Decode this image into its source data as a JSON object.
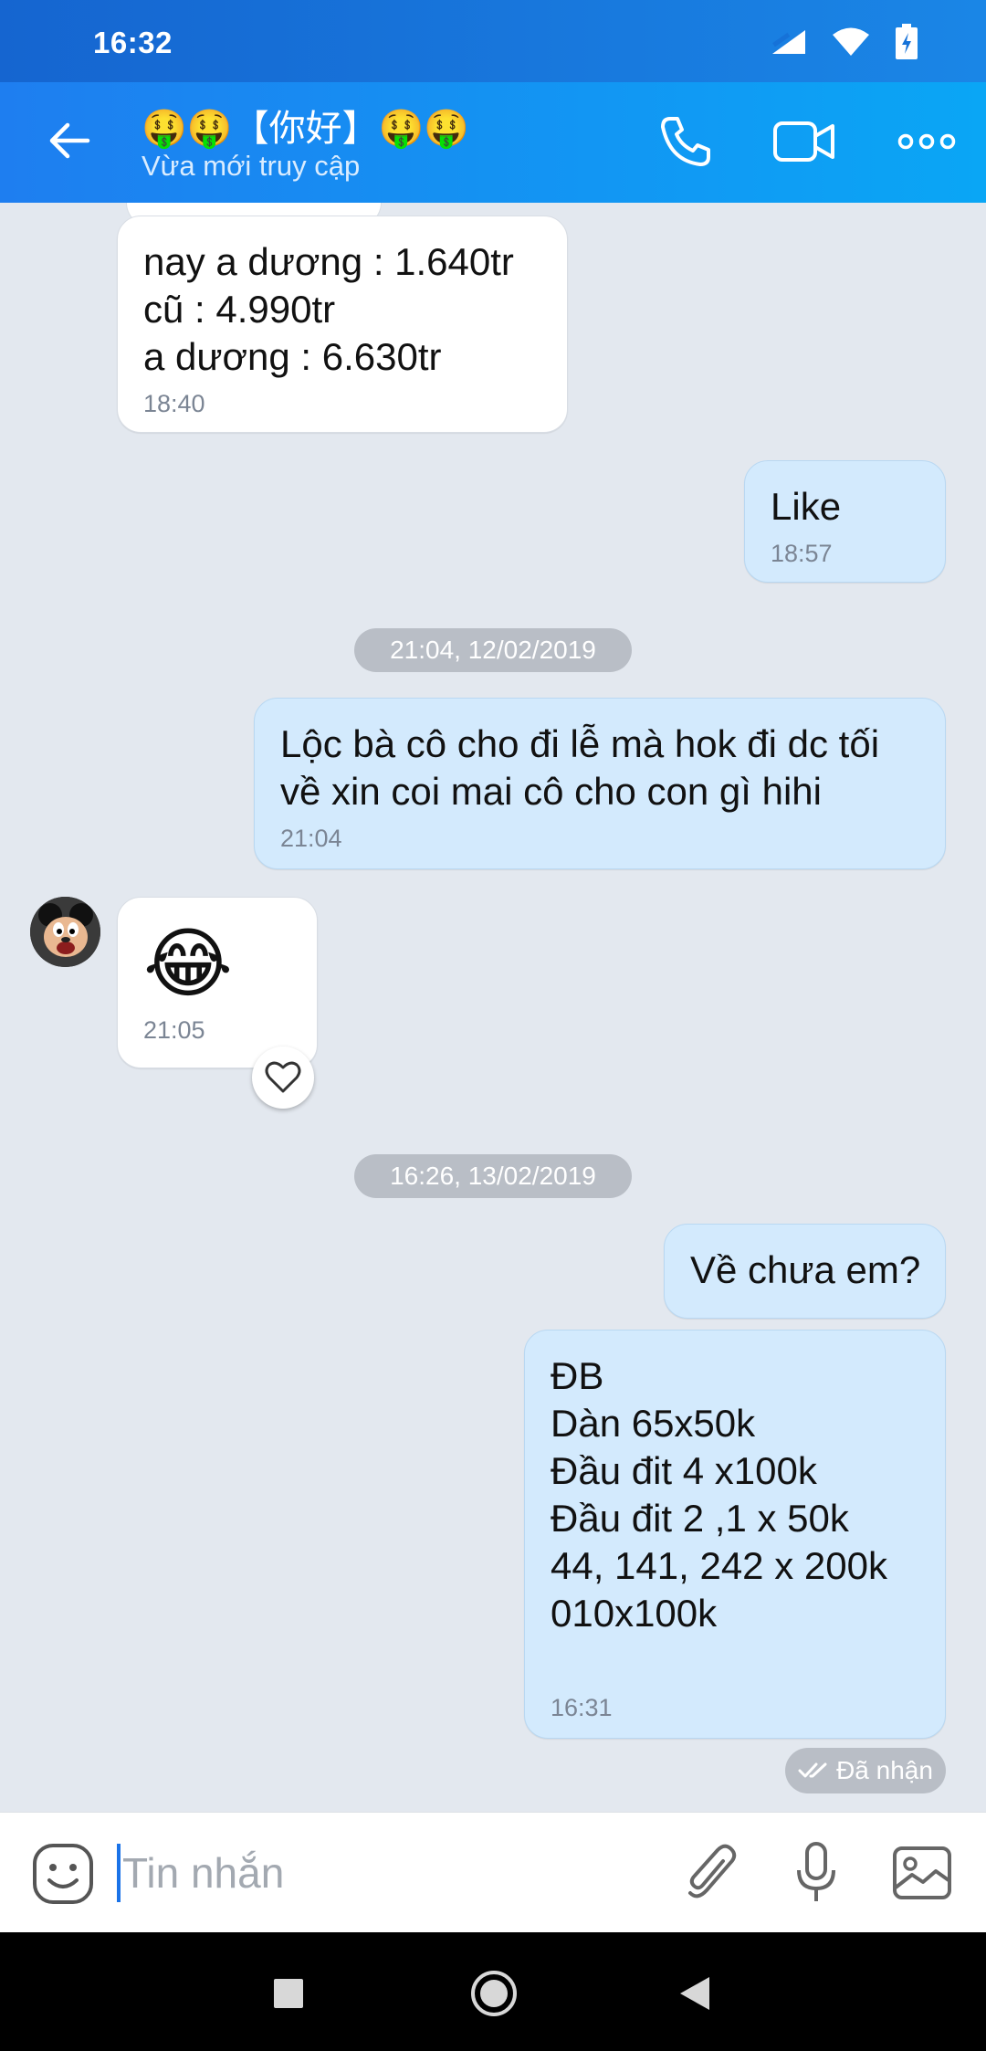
{
  "status_bar": {
    "time": "16:32"
  },
  "header": {
    "title": "🤑🤑【你好】🤑🤑",
    "subtitle": "Vừa mới truy cập",
    "accent_color": "#1e7ef0"
  },
  "dates": {
    "d1": "21:04, 12/02/2019",
    "d2": "16:26, 13/02/2019"
  },
  "messages": {
    "m1": {
      "lines": [
        "nay a dương : 1.640tr",
        "cũ : 4.990tr",
        "a dương : 6.630tr"
      ],
      "time": "18:40"
    },
    "m2": {
      "text": "Like",
      "time": "18:57"
    },
    "m3": {
      "lines": [
        "Lộc bà cô cho đi lễ mà hok đi dc tối",
        "về xin coi mai cô cho con gì hihi"
      ],
      "time": "21:04"
    },
    "m4": {
      "emoji": "😂",
      "time": "21:05"
    },
    "m5": {
      "text": "Về chưa em?"
    },
    "m6": {
      "lines": [
        "ĐB",
        "Dàn 65x50k",
        "Đầu đit 4 x100k",
        "Đầu đit 2 ,1 x 50k",
        "44, 141, 242 x 200k",
        "010x100k"
      ],
      "time": "16:31"
    }
  },
  "status": {
    "received": "Đã nhận"
  },
  "composer": {
    "placeholder": "Tin nhắn"
  },
  "icons": {
    "back": "arrow-left-icon",
    "call": "phone-icon",
    "video": "video-camera-icon",
    "more": "more-horizontal-icon",
    "emoji": "emoji-icon",
    "attach": "paperclip-icon",
    "mic": "microphone-icon",
    "image": "image-icon",
    "heart": "heart-icon"
  }
}
